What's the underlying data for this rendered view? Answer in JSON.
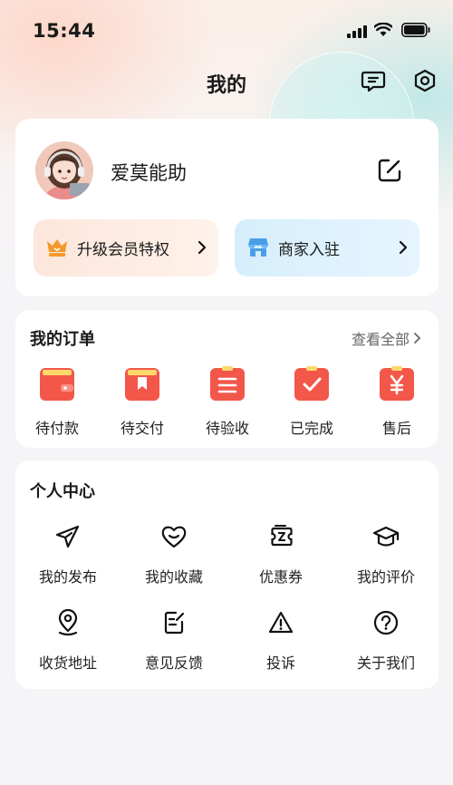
{
  "status_bar": {
    "time": "15:44"
  },
  "nav": {
    "title": "我的",
    "message_icon": "message-icon",
    "settings_icon": "settings-icon"
  },
  "profile": {
    "username": "爱莫能助",
    "avatar": "avatar-girl-headphones",
    "edit_icon": "edit-icon",
    "promos": [
      {
        "label": "升级会员特权",
        "icon": "crown-icon",
        "color": "#fde6dc"
      },
      {
        "label": "商家入驻",
        "icon": "store-icon",
        "color": "#d6eefc"
      }
    ]
  },
  "orders": {
    "title": "我的订单",
    "view_all": "查看全部",
    "items": [
      {
        "label": "待付款",
        "icon": "wallet-icon"
      },
      {
        "label": "待交付",
        "icon": "bookmark-box-icon"
      },
      {
        "label": "待验收",
        "icon": "clipboard-list-icon"
      },
      {
        "label": "已完成",
        "icon": "check-clipboard-icon"
      },
      {
        "label": "售后",
        "icon": "yen-icon"
      }
    ],
    "accent": "#f2574a"
  },
  "personal_center": {
    "title": "个人中心",
    "items": [
      {
        "label": "我的发布",
        "icon": "send-icon"
      },
      {
        "label": "我的收藏",
        "icon": "heart-icon"
      },
      {
        "label": "优惠券",
        "icon": "coupon-icon"
      },
      {
        "label": "我的评价",
        "icon": "graduation-cap-icon"
      },
      {
        "label": "收货地址",
        "icon": "location-icon"
      },
      {
        "label": "意见反馈",
        "icon": "feedback-icon"
      },
      {
        "label": "投诉",
        "icon": "warning-icon"
      },
      {
        "label": "关于我们",
        "icon": "help-icon"
      }
    ]
  }
}
